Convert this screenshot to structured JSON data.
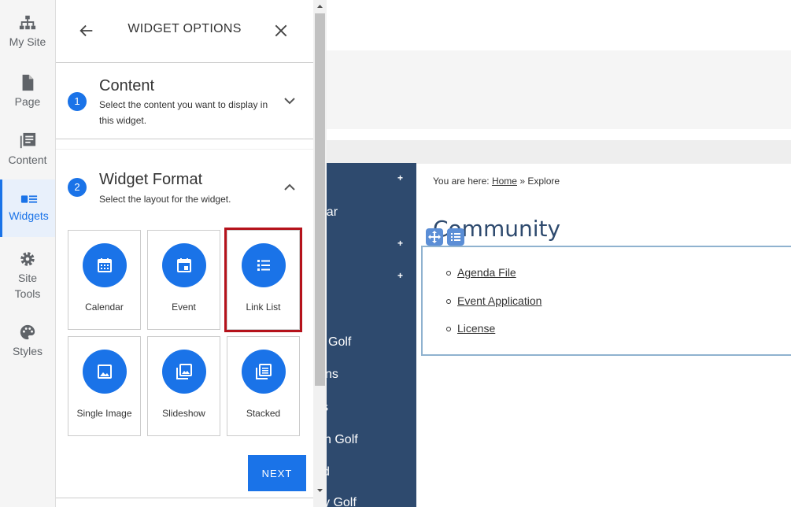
{
  "rail": {
    "items": [
      {
        "label": "My Site",
        "icon": "sitemap-icon"
      },
      {
        "label": "Page",
        "icon": "page-icon"
      },
      {
        "label": "Content",
        "icon": "content-icon"
      },
      {
        "label": "Widgets",
        "icon": "widgets-icon",
        "active": true
      },
      {
        "label": "Site\nTools",
        "icon": "gear-icon"
      },
      {
        "label": "Styles",
        "icon": "palette-icon"
      }
    ]
  },
  "panel": {
    "title": "WIDGET OPTIONS",
    "sections": [
      {
        "step": "1",
        "title": "Content",
        "description": "Select the content you want to display in this widget.",
        "expanded": false
      },
      {
        "step": "2",
        "title": "Widget Format",
        "description": "Select the layout for the widget.",
        "expanded": true
      }
    ],
    "formats": [
      {
        "label": "Calendar",
        "icon": "calendar-icon"
      },
      {
        "label": "Event",
        "icon": "event-icon"
      },
      {
        "label": "Link List",
        "icon": "link-list-icon",
        "selected": true
      },
      {
        "label": "Single Image",
        "icon": "image-icon"
      },
      {
        "label": "Slideshow",
        "icon": "slideshow-icon"
      },
      {
        "label": "Stacked",
        "icon": "stacked-icon"
      }
    ],
    "next_label": "NEXT"
  },
  "site": {
    "nav": [
      {
        "text": "ndar"
      },
      {
        "text": "Golf"
      },
      {
        "text": "ns"
      },
      {
        "text": "s"
      },
      {
        "text": "n Golf"
      },
      {
        "text": "d"
      },
      {
        "text": "y Golf"
      }
    ],
    "breadcrumb": {
      "prefix": "You are here:",
      "home": "Home",
      "separator": "»",
      "current": "Explore"
    },
    "heading": "Community",
    "links": [
      "Agenda File",
      "Event Application",
      "License"
    ]
  },
  "colors": {
    "accent": "#1a73e8",
    "selected_outline": "#b5121b",
    "site_nav": "#2e4a6e"
  }
}
